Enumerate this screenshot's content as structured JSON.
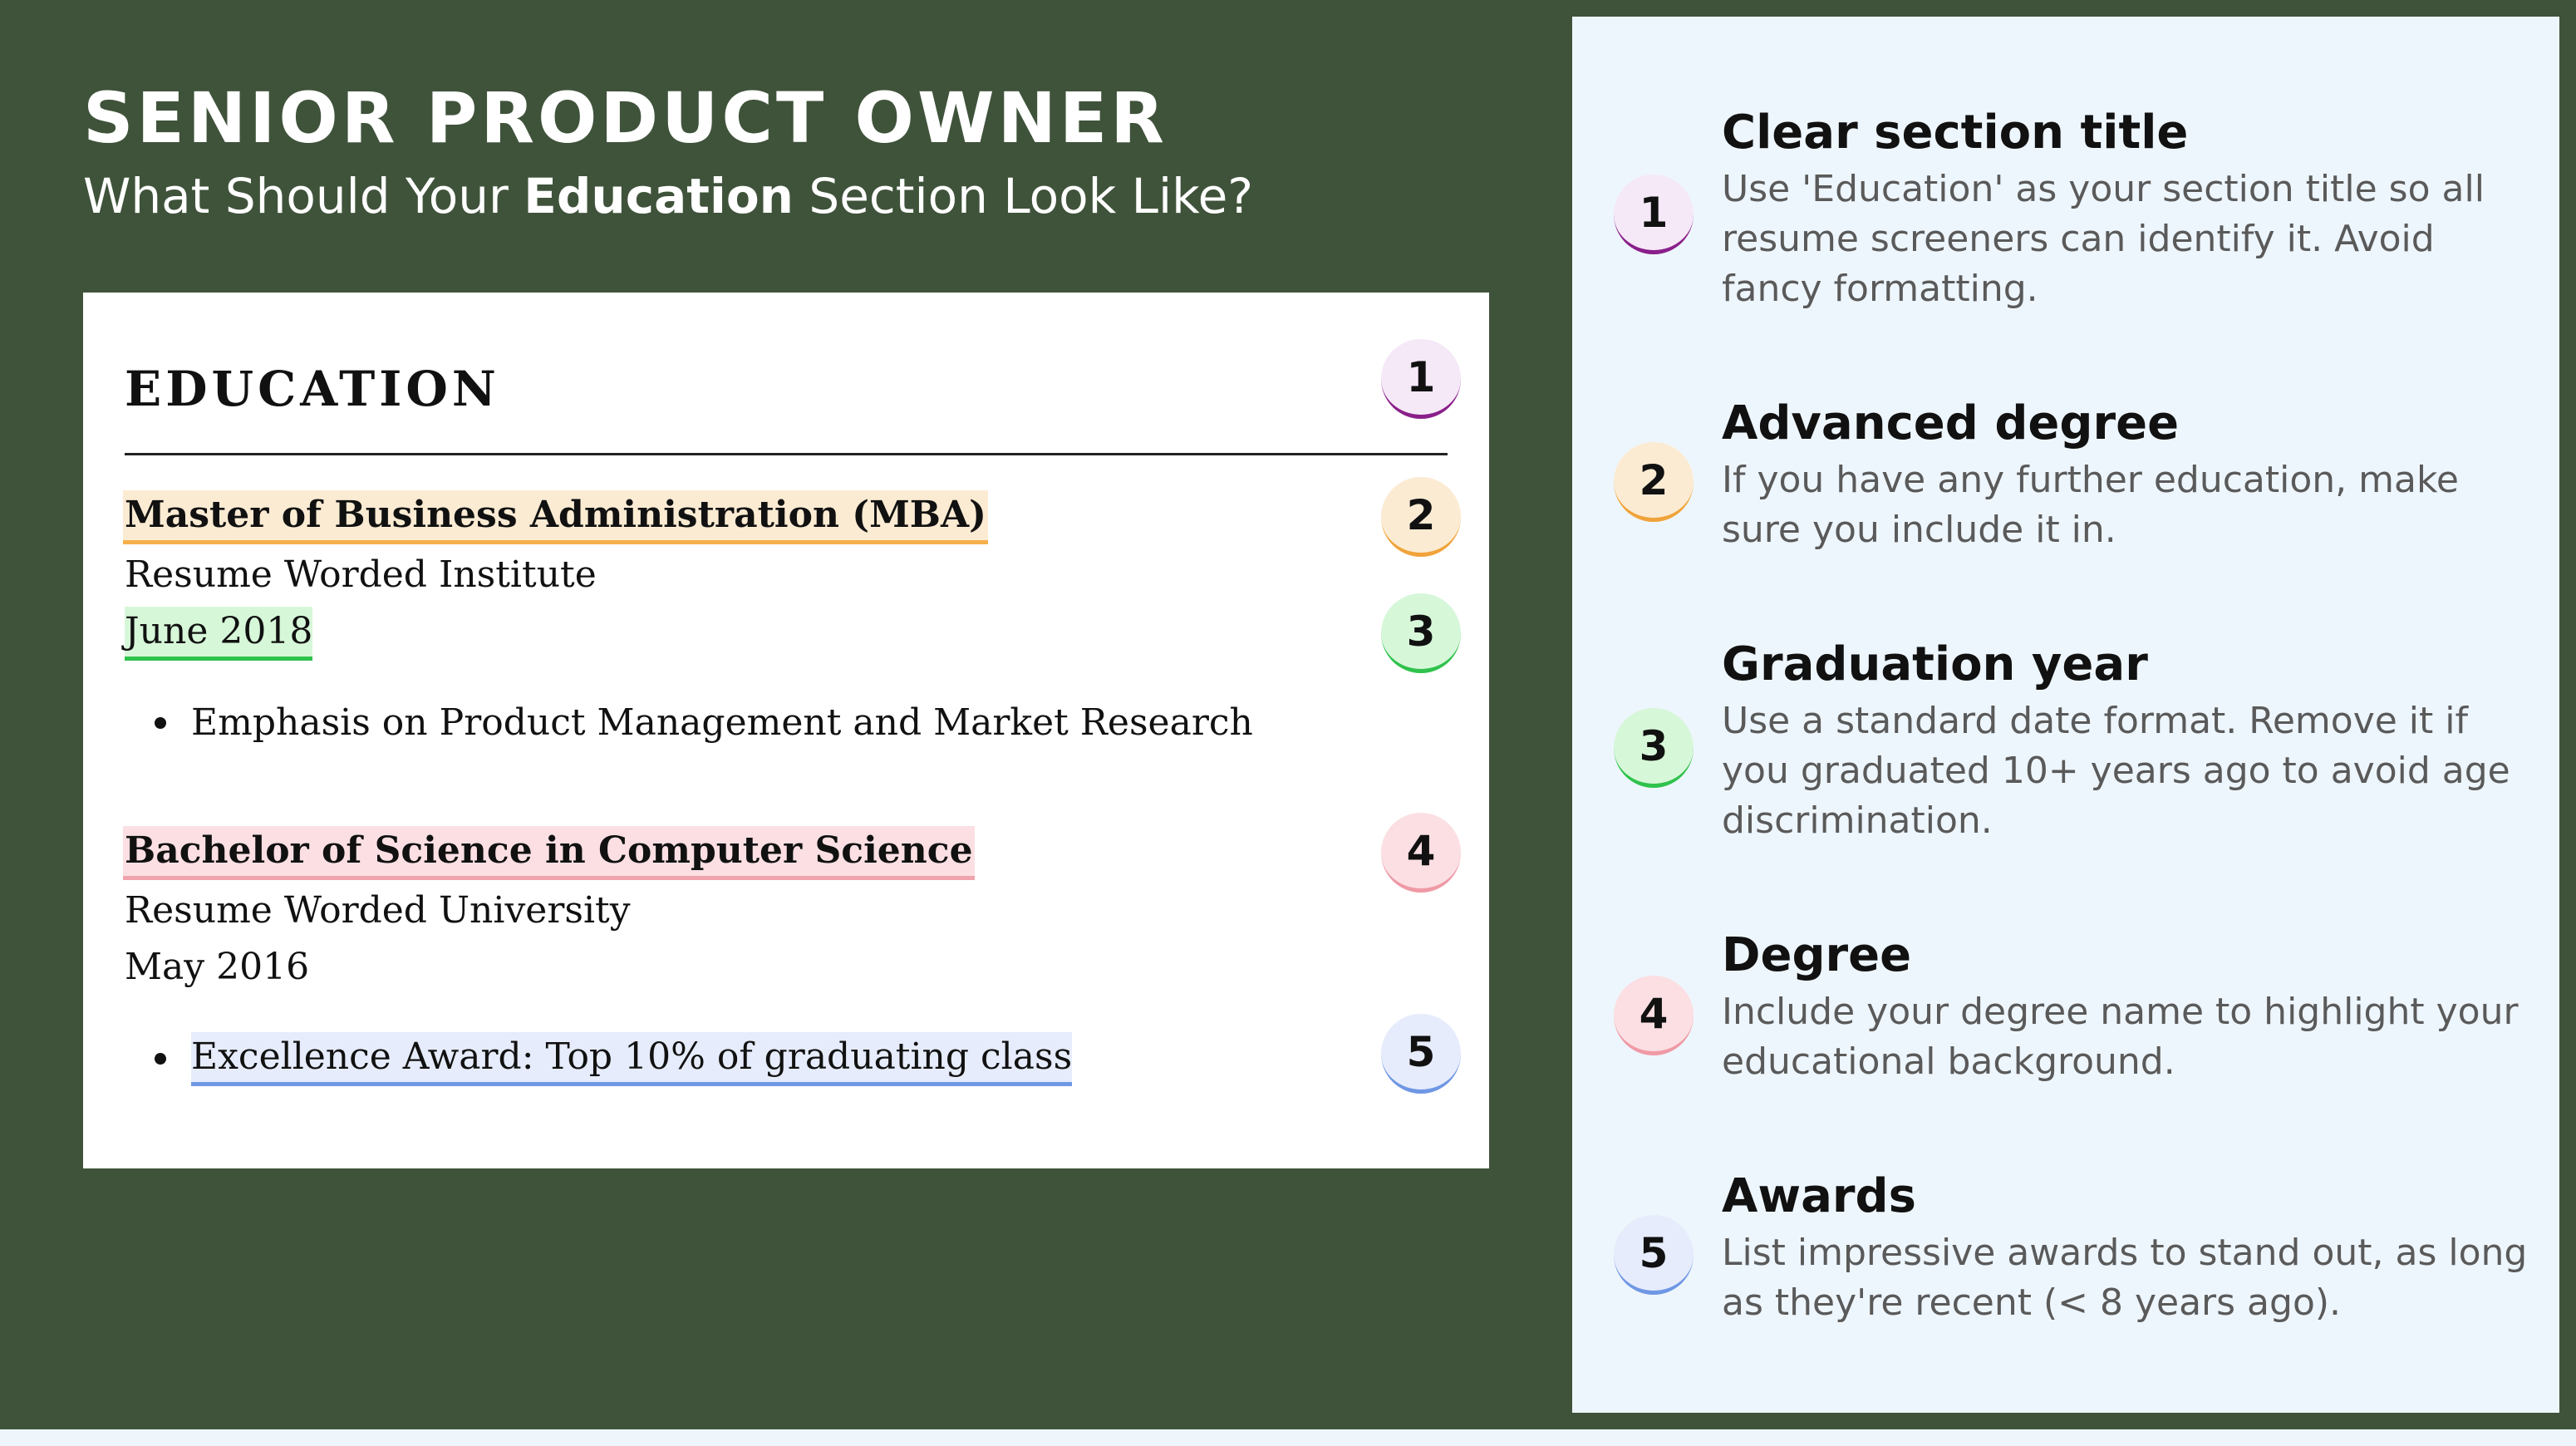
{
  "header": {
    "title": "SENIOR PRODUCT OWNER",
    "subtitle_pre": "What Should Your ",
    "subtitle_emphasis": "Education",
    "subtitle_post": " Section Look Like?"
  },
  "resume": {
    "section_heading": "EDUCATION",
    "entries": [
      {
        "degree": "Master of Business Administration (MBA)",
        "institution": "Resume Worded Institute",
        "date": "June 2018",
        "bullet": "Emphasis on Product Management and Market Research"
      },
      {
        "degree": "Bachelor of Science in Computer Science",
        "institution": "Resume Worded University",
        "date": "May 2016",
        "bullet": "Excellence Award: Top 10% of graduating class"
      }
    ],
    "badges": [
      "1",
      "2",
      "3",
      "4",
      "5"
    ]
  },
  "tips": [
    {
      "number": "1",
      "title": "Clear section title",
      "body": "Use 'Education' as your section title so all resume screeners can identify it. Avoid fancy formatting."
    },
    {
      "number": "2",
      "title": "Advanced degree",
      "body": "If you have any further education, make sure you include it in."
    },
    {
      "number": "3",
      "title": "Graduation year",
      "body": "Use a standard date format. Remove it if you graduated 10+ years ago to avoid age discrimination."
    },
    {
      "number": "4",
      "title": "Degree",
      "body": "Include your degree name to highlight your educational background."
    },
    {
      "number": "5",
      "title": "Awards",
      "body": "List impressive awards to stand out, as long as they're recent (< 8 years ago)."
    }
  ],
  "colors": {
    "background": "#3f533a",
    "panel": "#eef6fd",
    "badge_1": "#8a1f8a",
    "badge_2": "#f0a33a",
    "badge_3": "#2fc24c",
    "badge_4": "#ef9aa6",
    "badge_5": "#6f97e4"
  }
}
